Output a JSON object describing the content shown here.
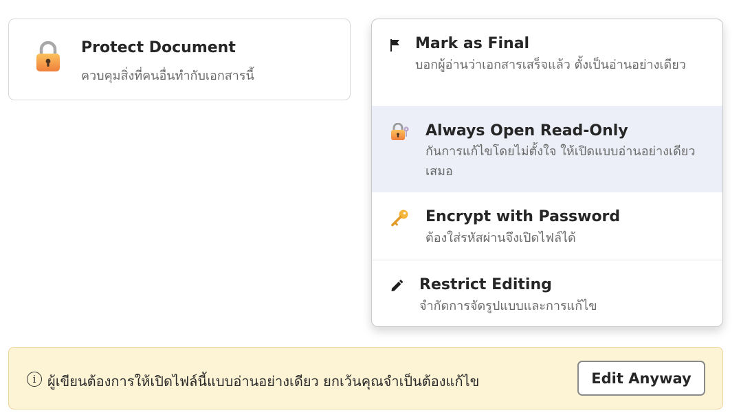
{
  "protect_card": {
    "icon": "padlock-icon",
    "title": "Protect Document",
    "description": "ควบคุมสิ่งที่คนอื่นทำกับเอกสารนี้"
  },
  "menu": {
    "items": [
      {
        "icon": "flag-icon",
        "title": "Mark as Final",
        "description": "บอกผู้อ่านว่าเอกสารเสร็จแล้ว ตั้งเป็นอ่านอย่างเดียว"
      },
      {
        "icon": "lock-with-key-icon",
        "title": "Always Open Read-Only",
        "description": "กันการแก้ไขโดยไม่ตั้งใจ ให้เปิดแบบอ่านอย่างเดียวเสมอ",
        "highlighted": true
      },
      {
        "icon": "key-icon",
        "title": "Encrypt with Password",
        "description": "ต้องใส่รหัสผ่านจึงเปิดไฟล์ได้"
      },
      {
        "icon": "pencil-icon",
        "title": "Restrict Editing",
        "description": "จำกัดการจัดรูปแบบและการแก้ไข"
      }
    ]
  },
  "infobar": {
    "icon": "info-icon",
    "icon_glyph": "i",
    "message": "ผู้เขียนต้องการให้เปิดไฟล์นี้แบบอ่านอย่างเดียว ยกเว้นคุณจำเป็นต้องแก้ไข",
    "button_label": "Edit Anyway"
  },
  "colors": {
    "hover_background": "#eceff7",
    "infobar_background": "#fdf3d5",
    "lock_orange": "#f2a24a"
  }
}
